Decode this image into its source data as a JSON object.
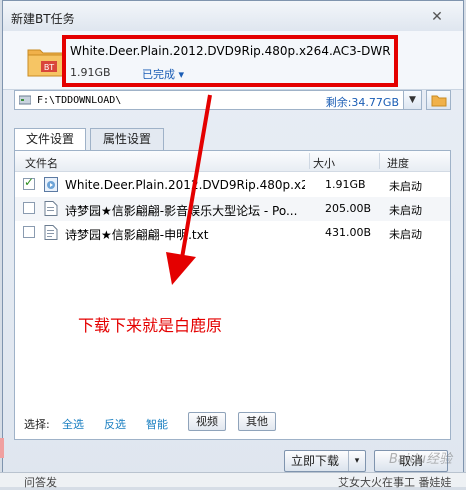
{
  "window": {
    "title": "新建BT任务"
  },
  "torrent": {
    "name": "White.Deer.Plain.2012.DVD9Rip.480p.x264.AC3-DWR",
    "size": "1.91GB",
    "status": "已完成",
    "folder_badge": "BT"
  },
  "path": {
    "value": "F:\\TDDOWNLOAD\\",
    "remaining": "剩余:34.77GB"
  },
  "tabs": [
    {
      "label": "文件设置"
    },
    {
      "label": "属性设置"
    }
  ],
  "table": {
    "headers": [
      "文件名",
      "大小",
      "进度"
    ],
    "rows": [
      {
        "name": "White.Deer.Plain.2012.DVD9Rip.480p.x2...",
        "size": "1.91GB",
        "status": "未启动",
        "checked": true
      },
      {
        "name": "诗梦园★信影翩翩-影音娱乐大型论坛 - Po...",
        "size": "205.00B",
        "status": "未启动",
        "checked": false
      },
      {
        "name": "诗梦园★信影翩翩-申明.txt",
        "size": "431.00B",
        "status": "未启动",
        "checked": false
      }
    ]
  },
  "annotation": "下载下来就是白鹿原",
  "select_bar": {
    "label": "选择:",
    "all": "全选",
    "invert": "反选",
    "smart": "智能",
    "video": "视频",
    "other": "其他"
  },
  "buttons": {
    "download_now": "立即下载",
    "cancel": "取消"
  },
  "background": {
    "bottom_left": "问答发",
    "bottom_right": "艾女大火在事工 番娃娃"
  },
  "watermark": "Baidu经验",
  "colors": {
    "highlight": "#e40000",
    "link": "#1a7fc1"
  }
}
